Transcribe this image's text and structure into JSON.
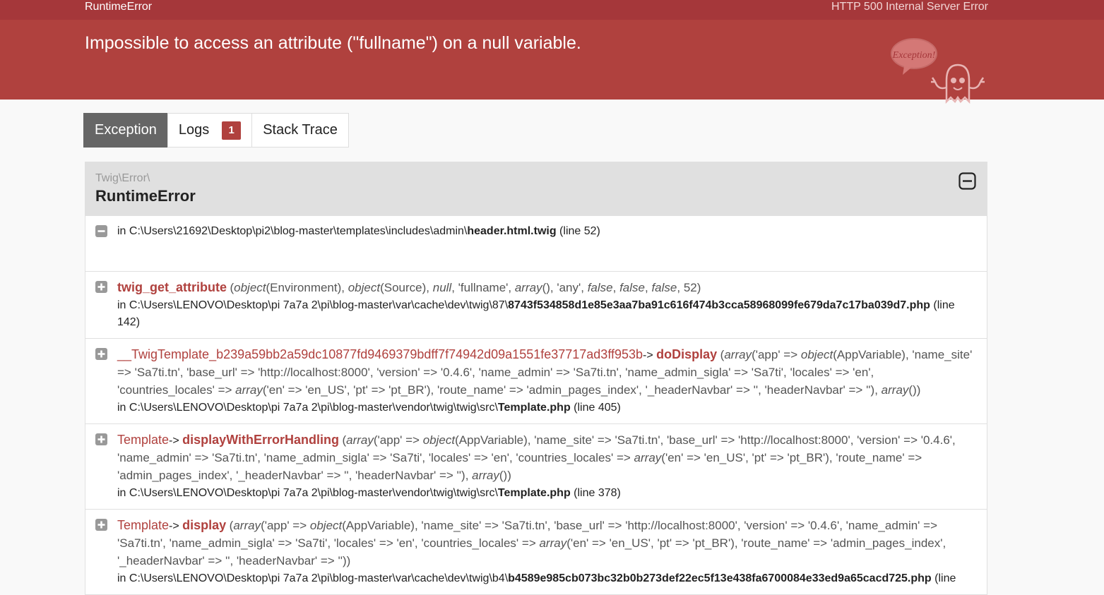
{
  "topbar": {
    "exception_class": "RuntimeError",
    "status": "HTTP 500 Internal Server Error"
  },
  "header": {
    "message": "Impossible to access an attribute (\"fullname\") on a null variable.",
    "ghost_text": "Exception!"
  },
  "tabs": [
    {
      "label": "Exception",
      "active": true
    },
    {
      "label": "Logs",
      "badge": "1"
    },
    {
      "label": "Stack Trace"
    }
  ],
  "exception": {
    "namespace": "Twig\\Error\\",
    "class": "RuntimeError"
  },
  "traces": [
    {
      "file_prefix": "in C:\\Users\\21692\\Desktop\\pi2\\blog-master\\templates\\includes\\admin\\",
      "file_name": "header.html.twig",
      "line_text": " (line 52)"
    },
    {
      "function": "twig_get_attribute",
      "args_html": "(<i>object</i>(Environment), <i>object</i>(Source), <i>null</i>, 'fullname', <i>array</i>(), 'any', <i>false</i>, <i>false</i>, <i>false</i>, 52)",
      "file_prefix": "in C:\\Users\\LENOVO\\Desktop\\pi 7a7a 2\\pi\\blog-master\\var\\cache\\dev\\twig\\87\\",
      "file_name": "8743f534858d1e85e3aa7ba91c616f474b3cca58968099fe679da7c17ba039d7.php",
      "line_text": " (line 142)"
    },
    {
      "class": "__TwigTemplate_b239a59bb2a59dc10877fd9469379bdff7f74942d09a1551fe37717ad3ff953b",
      "type": "->",
      "function": "doDisplay",
      "args_html": "(<i>array</i>('app' => <i>object</i>(AppVariable), 'name_site' => 'Sa7ti.tn', 'base_url' => 'http://localhost:8000', 'version' => '0.4.6', 'name_admin' => 'Sa7ti.tn', 'name_admin_sigla' => 'Sa7ti', 'locales' => 'en', 'countries_locales' => <i>array</i>('en' => 'en_US', 'pt' => 'pt_BR'), 'route_name' => 'admin_pages_index', '_headerNavbar' => '', 'headerNavbar' => ''), <i>array</i>())",
      "file_prefix": "in C:\\Users\\LENOVO\\Desktop\\pi 7a7a 2\\pi\\blog-master\\vendor\\twig\\twig\\src\\",
      "file_name": "Template.php",
      "line_text": " (line 405)"
    },
    {
      "class": "Template",
      "type": "->",
      "function": "displayWithErrorHandling",
      "args_html": "(<i>array</i>('app' => <i>object</i>(AppVariable), 'name_site' => 'Sa7ti.tn', 'base_url' => 'http://localhost:8000', 'version' => '0.4.6', 'name_admin' => 'Sa7ti.tn', 'name_admin_sigla' => 'Sa7ti', 'locales' => 'en', 'countries_locales' => <i>array</i>('en' => 'en_US', 'pt' => 'pt_BR'), 'route_name' => 'admin_pages_index', '_headerNavbar' => '', 'headerNavbar' => ''), <i>array</i>())",
      "file_prefix": "in C:\\Users\\LENOVO\\Desktop\\pi 7a7a 2\\pi\\blog-master\\vendor\\twig\\twig\\src\\",
      "file_name": "Template.php",
      "line_text": " (line 378)"
    },
    {
      "class": "Template",
      "type": "->",
      "function": "display",
      "args_html": "(<i>array</i>('app' => <i>object</i>(AppVariable), 'name_site' => 'Sa7ti.tn', 'base_url' => 'http://localhost:8000', 'version' => '0.4.6', 'name_admin' => 'Sa7ti.tn', 'name_admin_sigla' => 'Sa7ti', 'locales' => 'en', 'countries_locales' => <i>array</i>('en' => 'en_US', 'pt' => 'pt_BR'), 'route_name' => 'admin_pages_index', '_headerNavbar' => '', 'headerNavbar' => ''))",
      "file_prefix": "in C:\\Users\\LENOVO\\Desktop\\pi 7a7a 2\\pi\\blog-master\\var\\cache\\dev\\twig\\b4\\",
      "file_name": "b4589e985cb073bc32b0b273def22ec5f13e438fa6700084e33ed9a65cacd725.php",
      "line_text": " (line"
    }
  ],
  "colors": {
    "topbar": "#a5373a",
    "header": "#b0413e",
    "accent": "#b0413e",
    "tab_active": "#666666"
  },
  "icons": {
    "collapse": "minus-square-icon",
    "expand": "plus-square-icon"
  }
}
